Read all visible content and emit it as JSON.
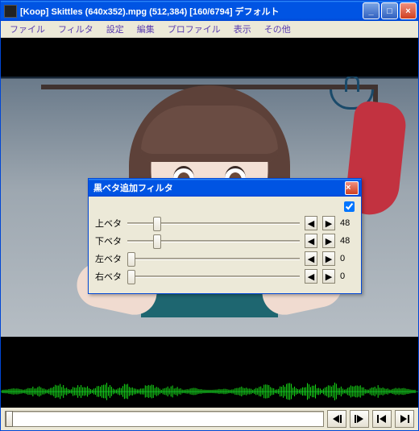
{
  "window": {
    "title": "[Koop] Skittles (640x352).mpg (512,384) [160/6794] デフォルト"
  },
  "menu": {
    "items": [
      "ファイル",
      "フィルタ",
      "設定",
      "編集",
      "プロファイル",
      "表示",
      "その他"
    ]
  },
  "dialog": {
    "title": "黒ベタ追加フィルタ",
    "checked": true,
    "rows": [
      {
        "label": "上ベタ",
        "value": "48",
        "pos": 15
      },
      {
        "label": "下ベタ",
        "value": "48",
        "pos": 15
      },
      {
        "label": "左ベタ",
        "value": "0",
        "pos": 0
      },
      {
        "label": "右ベタ",
        "value": "0",
        "pos": 0
      }
    ]
  },
  "transport": {
    "step_back": "◀│",
    "step_fwd": "│▶",
    "prev": "│◀",
    "next": "▶│"
  },
  "glyph": {
    "left": "◀",
    "right": "▶",
    "close": "×",
    "min": "_",
    "max": "□"
  }
}
